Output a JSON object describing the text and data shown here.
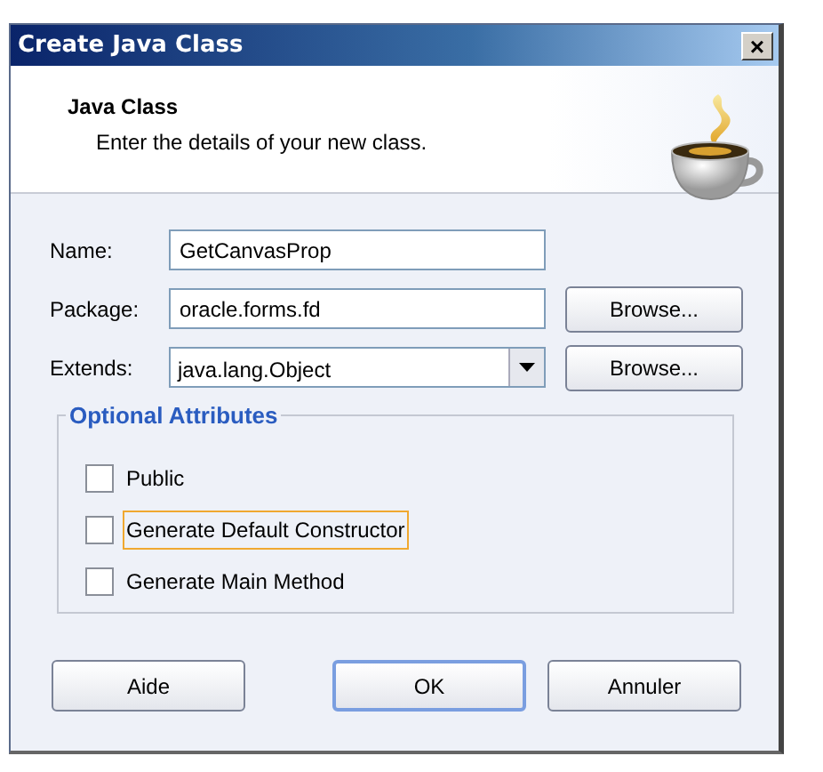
{
  "window": {
    "title": "Create Java Class",
    "close": "×"
  },
  "header": {
    "title": "Java Class",
    "subtitle": "Enter the details of your new class."
  },
  "fields": [
    {
      "label": "Name:",
      "value": "GetCanvasProp",
      "kind": "text"
    },
    {
      "label": "Package:",
      "value": "oracle.forms.fd",
      "kind": "text",
      "button": {
        "label": "Browse..."
      }
    },
    {
      "label": "Extends:",
      "value": "java.lang.Object",
      "kind": "combo",
      "button": {
        "label": "Browse..."
      }
    }
  ],
  "group": {
    "title": "Optional Attributes",
    "options": [
      {
        "label": "Public",
        "checked": false,
        "focused": false
      },
      {
        "label": "Generate Default Constructor",
        "checked": false,
        "focused": true
      },
      {
        "label": "Generate Main Method",
        "checked": false,
        "focused": false
      }
    ]
  },
  "buttons": [
    {
      "label": "Aide",
      "default": false
    },
    {
      "label": "OK",
      "default": true
    },
    {
      "label": "Annuler",
      "default": false
    }
  ]
}
